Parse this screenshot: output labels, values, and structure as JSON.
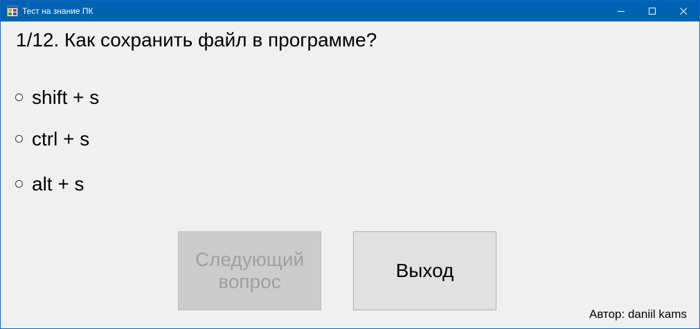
{
  "window": {
    "title": "Тест на знание ПК",
    "titlebar_color": "#0063b1",
    "controls": [
      "minimize-icon",
      "maximize-icon",
      "close-icon"
    ]
  },
  "question": {
    "text": "1/12. Как сохранить файл в программе?"
  },
  "options": [
    {
      "label": "shift + s",
      "selected": false
    },
    {
      "label": "ctrl + s",
      "selected": false
    },
    {
      "label": "alt + s",
      "selected": false
    }
  ],
  "buttons": {
    "next_label": "Следующий\nвопрос",
    "next_enabled": false,
    "exit_label": "Выход"
  },
  "footer": {
    "author": "Автор: daniil kams"
  }
}
